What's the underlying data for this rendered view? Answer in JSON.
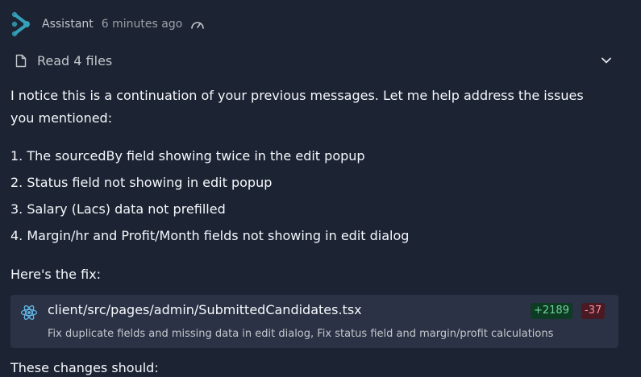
{
  "header": {
    "author": "Assistant",
    "time": "6 minutes ago",
    "logo_icon": "assistant-logo-icon",
    "gauge_icon": "gauge-icon"
  },
  "files_read": {
    "label": "Read 4 files",
    "icon": "file-icon",
    "toggle_icon": "chevron-down-icon"
  },
  "message": {
    "intro": "I notice this is a continuation of your previous messages. Let me help address the issues you mentioned:",
    "issues": [
      "1. The sourcedBy field showing twice in the edit popup",
      "2. Status field not showing in edit popup",
      "3. Salary (Lacs) data not prefilled",
      "4. Margin/hr and Profit/Month fields not showing in edit dialog"
    ],
    "fix_intro": "Here's the fix:",
    "outro": "These changes should:"
  },
  "file_change": {
    "icon": "react-icon",
    "path": "client/src/pages/admin/SubmittedCandidates.tsx",
    "additions": "+2189",
    "deletions": "-37",
    "description": "Fix duplicate fields and missing data in edit dialog, Fix status field and margin/profit calculations"
  },
  "colors": {
    "background": "#1c2333",
    "card": "#2b3245",
    "logo": "#35a0ba",
    "add": "#6fd39a",
    "delete": "#ff8c9a"
  }
}
